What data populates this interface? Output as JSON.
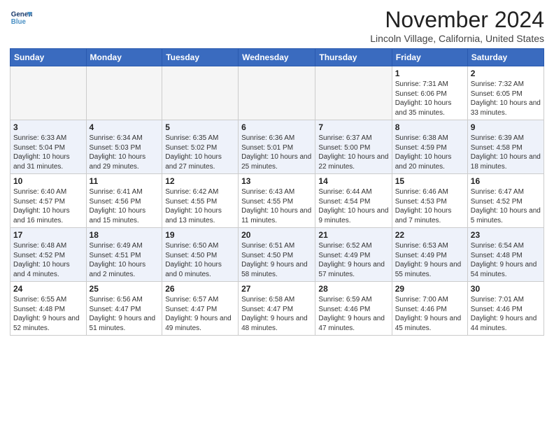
{
  "header": {
    "logo_line1": "General",
    "logo_line2": "Blue",
    "month": "November 2024",
    "location": "Lincoln Village, California, United States"
  },
  "days_of_week": [
    "Sunday",
    "Monday",
    "Tuesday",
    "Wednesday",
    "Thursday",
    "Friday",
    "Saturday"
  ],
  "weeks": [
    [
      {
        "num": "",
        "info": ""
      },
      {
        "num": "",
        "info": ""
      },
      {
        "num": "",
        "info": ""
      },
      {
        "num": "",
        "info": ""
      },
      {
        "num": "",
        "info": ""
      },
      {
        "num": "1",
        "info": "Sunrise: 7:31 AM\nSunset: 6:06 PM\nDaylight: 10 hours and 35 minutes."
      },
      {
        "num": "2",
        "info": "Sunrise: 7:32 AM\nSunset: 6:05 PM\nDaylight: 10 hours and 33 minutes."
      }
    ],
    [
      {
        "num": "3",
        "info": "Sunrise: 6:33 AM\nSunset: 5:04 PM\nDaylight: 10 hours and 31 minutes."
      },
      {
        "num": "4",
        "info": "Sunrise: 6:34 AM\nSunset: 5:03 PM\nDaylight: 10 hours and 29 minutes."
      },
      {
        "num": "5",
        "info": "Sunrise: 6:35 AM\nSunset: 5:02 PM\nDaylight: 10 hours and 27 minutes."
      },
      {
        "num": "6",
        "info": "Sunrise: 6:36 AM\nSunset: 5:01 PM\nDaylight: 10 hours and 25 minutes."
      },
      {
        "num": "7",
        "info": "Sunrise: 6:37 AM\nSunset: 5:00 PM\nDaylight: 10 hours and 22 minutes."
      },
      {
        "num": "8",
        "info": "Sunrise: 6:38 AM\nSunset: 4:59 PM\nDaylight: 10 hours and 20 minutes."
      },
      {
        "num": "9",
        "info": "Sunrise: 6:39 AM\nSunset: 4:58 PM\nDaylight: 10 hours and 18 minutes."
      }
    ],
    [
      {
        "num": "10",
        "info": "Sunrise: 6:40 AM\nSunset: 4:57 PM\nDaylight: 10 hours and 16 minutes."
      },
      {
        "num": "11",
        "info": "Sunrise: 6:41 AM\nSunset: 4:56 PM\nDaylight: 10 hours and 15 minutes."
      },
      {
        "num": "12",
        "info": "Sunrise: 6:42 AM\nSunset: 4:55 PM\nDaylight: 10 hours and 13 minutes."
      },
      {
        "num": "13",
        "info": "Sunrise: 6:43 AM\nSunset: 4:55 PM\nDaylight: 10 hours and 11 minutes."
      },
      {
        "num": "14",
        "info": "Sunrise: 6:44 AM\nSunset: 4:54 PM\nDaylight: 10 hours and 9 minutes."
      },
      {
        "num": "15",
        "info": "Sunrise: 6:46 AM\nSunset: 4:53 PM\nDaylight: 10 hours and 7 minutes."
      },
      {
        "num": "16",
        "info": "Sunrise: 6:47 AM\nSunset: 4:52 PM\nDaylight: 10 hours and 5 minutes."
      }
    ],
    [
      {
        "num": "17",
        "info": "Sunrise: 6:48 AM\nSunset: 4:52 PM\nDaylight: 10 hours and 4 minutes."
      },
      {
        "num": "18",
        "info": "Sunrise: 6:49 AM\nSunset: 4:51 PM\nDaylight: 10 hours and 2 minutes."
      },
      {
        "num": "19",
        "info": "Sunrise: 6:50 AM\nSunset: 4:50 PM\nDaylight: 10 hours and 0 minutes."
      },
      {
        "num": "20",
        "info": "Sunrise: 6:51 AM\nSunset: 4:50 PM\nDaylight: 9 hours and 58 minutes."
      },
      {
        "num": "21",
        "info": "Sunrise: 6:52 AM\nSunset: 4:49 PM\nDaylight: 9 hours and 57 minutes."
      },
      {
        "num": "22",
        "info": "Sunrise: 6:53 AM\nSunset: 4:49 PM\nDaylight: 9 hours and 55 minutes."
      },
      {
        "num": "23",
        "info": "Sunrise: 6:54 AM\nSunset: 4:48 PM\nDaylight: 9 hours and 54 minutes."
      }
    ],
    [
      {
        "num": "24",
        "info": "Sunrise: 6:55 AM\nSunset: 4:48 PM\nDaylight: 9 hours and 52 minutes."
      },
      {
        "num": "25",
        "info": "Sunrise: 6:56 AM\nSunset: 4:47 PM\nDaylight: 9 hours and 51 minutes."
      },
      {
        "num": "26",
        "info": "Sunrise: 6:57 AM\nSunset: 4:47 PM\nDaylight: 9 hours and 49 minutes."
      },
      {
        "num": "27",
        "info": "Sunrise: 6:58 AM\nSunset: 4:47 PM\nDaylight: 9 hours and 48 minutes."
      },
      {
        "num": "28",
        "info": "Sunrise: 6:59 AM\nSunset: 4:46 PM\nDaylight: 9 hours and 47 minutes."
      },
      {
        "num": "29",
        "info": "Sunrise: 7:00 AM\nSunset: 4:46 PM\nDaylight: 9 hours and 45 minutes."
      },
      {
        "num": "30",
        "info": "Sunrise: 7:01 AM\nSunset: 4:46 PM\nDaylight: 9 hours and 44 minutes."
      }
    ]
  ]
}
